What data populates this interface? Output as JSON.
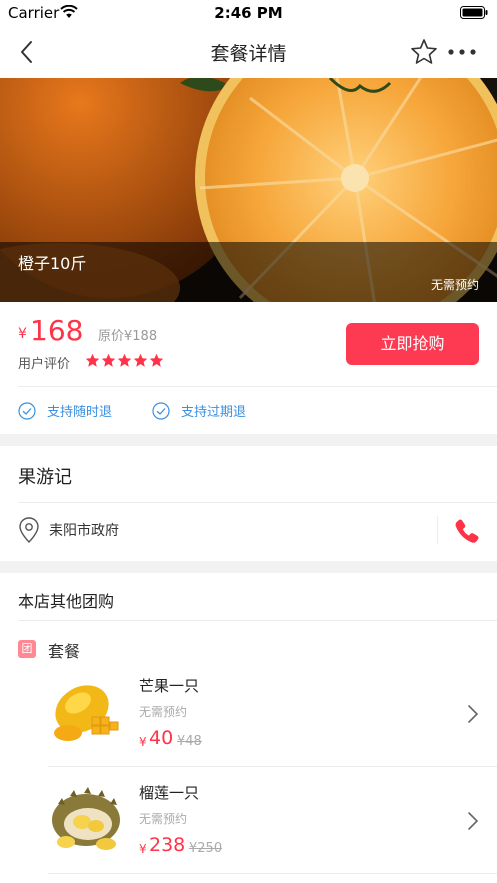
{
  "status_bar": {
    "carrier": "Carrier",
    "time": "2:46 PM"
  },
  "nav": {
    "title": "套餐详情",
    "icons": [
      "back-icon",
      "star-outline-icon",
      "more-icon"
    ]
  },
  "hero": {
    "title": "橙子10斤",
    "note": "无需预约"
  },
  "purchase": {
    "currency": "¥",
    "price": "168",
    "original_price": "原价¥188",
    "rating_label": "用户评价",
    "rating": 5,
    "rating_max": 5,
    "buy_label": "立即抢购",
    "guarantees": [
      "支持随时退",
      "支持过期退"
    ]
  },
  "shop": {
    "name": "果游记",
    "address": "耒阳市政府"
  },
  "group_deals": {
    "heading": "本店其他团购",
    "category_badge": "团",
    "category_name": "套餐",
    "items": [
      {
        "name": "芒果一只",
        "note": "无需预约",
        "currency": "¥",
        "price": "40",
        "original": "¥48"
      },
      {
        "name": "榴莲一只",
        "note": "无需预约",
        "currency": "¥",
        "price": "238",
        "original": "¥250"
      }
    ]
  },
  "colors": {
    "accent": "#ff3347",
    "button": "#fe3a52",
    "link_blue": "#3a8fe0",
    "badge": "#ff8892"
  }
}
